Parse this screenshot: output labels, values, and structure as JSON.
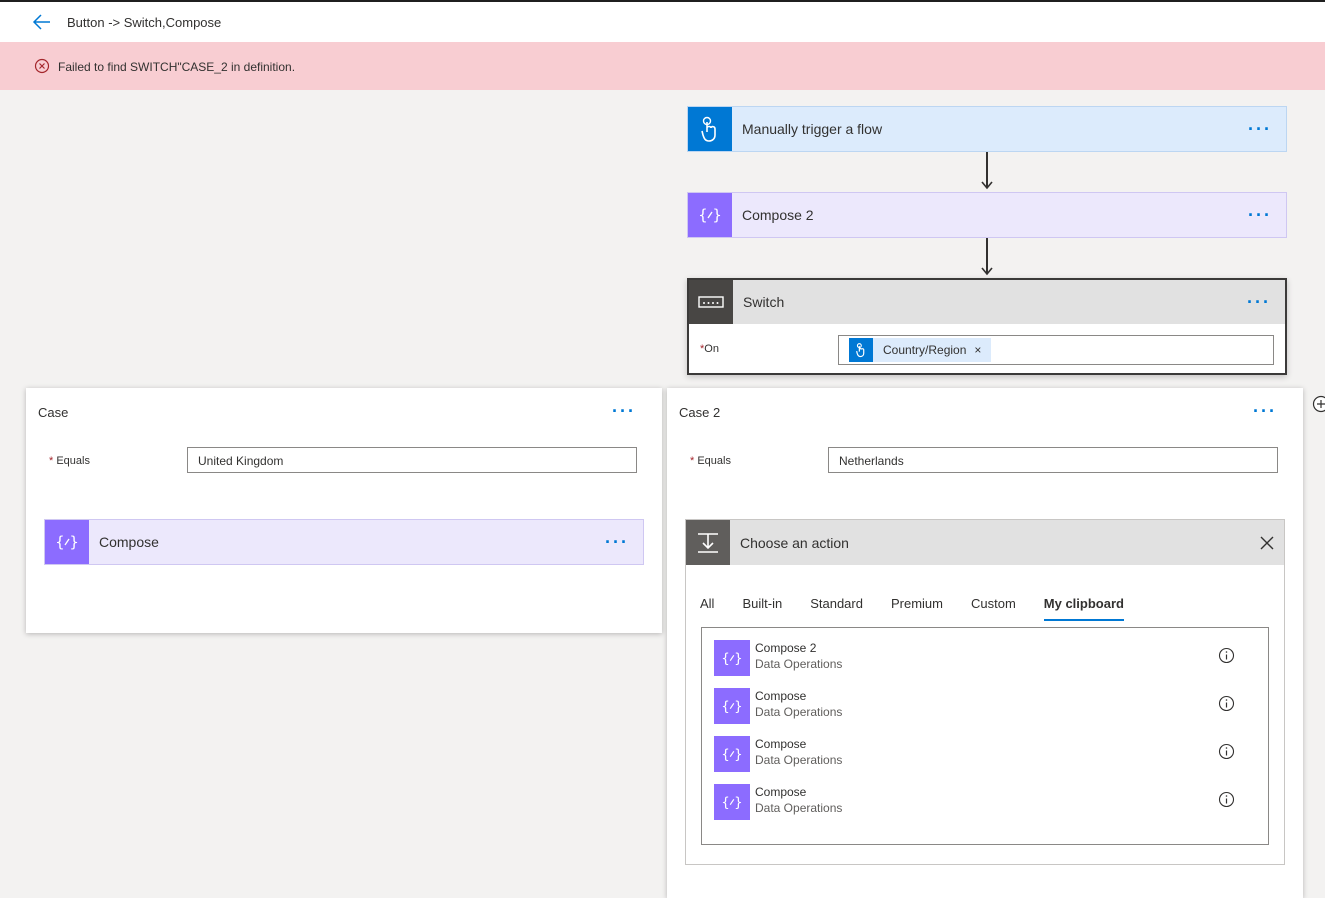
{
  "header": {
    "title": "Button -> Switch,Compose"
  },
  "error": {
    "message": "Failed to find SWITCH\"CASE_2 in definition."
  },
  "colors": {
    "trigger_blue": "#0078d4",
    "compose_purple": "#8c6cff",
    "error_bg": "#f8cdd2"
  },
  "flow": {
    "trigger": {
      "title": "Manually trigger a flow",
      "icon": "hand-touch-icon"
    },
    "compose2": {
      "title": "Compose 2",
      "icon": "compose-braces-icon"
    },
    "switch": {
      "title": "Switch",
      "on_label": "On",
      "token": "Country/Region",
      "token_remove": "×"
    }
  },
  "case1": {
    "title": "Case",
    "equals_label": "Equals",
    "equals_value": "United Kingdom",
    "action_title": "Compose"
  },
  "case2": {
    "title": "Case 2",
    "equals_label": "Equals",
    "equals_value": "Netherlands",
    "chooser": {
      "title": "Choose an action",
      "tabs": [
        {
          "label": "All"
        },
        {
          "label": "Built-in"
        },
        {
          "label": "Standard"
        },
        {
          "label": "Premium"
        },
        {
          "label": "Custom"
        },
        {
          "label": "My clipboard",
          "active": true
        }
      ],
      "items": [
        {
          "name": "Compose 2",
          "connector": "Data Operations"
        },
        {
          "name": "Compose",
          "connector": "Data Operations"
        },
        {
          "name": "Compose",
          "connector": "Data Operations"
        },
        {
          "name": "Compose",
          "connector": "Data Operations"
        }
      ]
    }
  },
  "more_dots": "···"
}
